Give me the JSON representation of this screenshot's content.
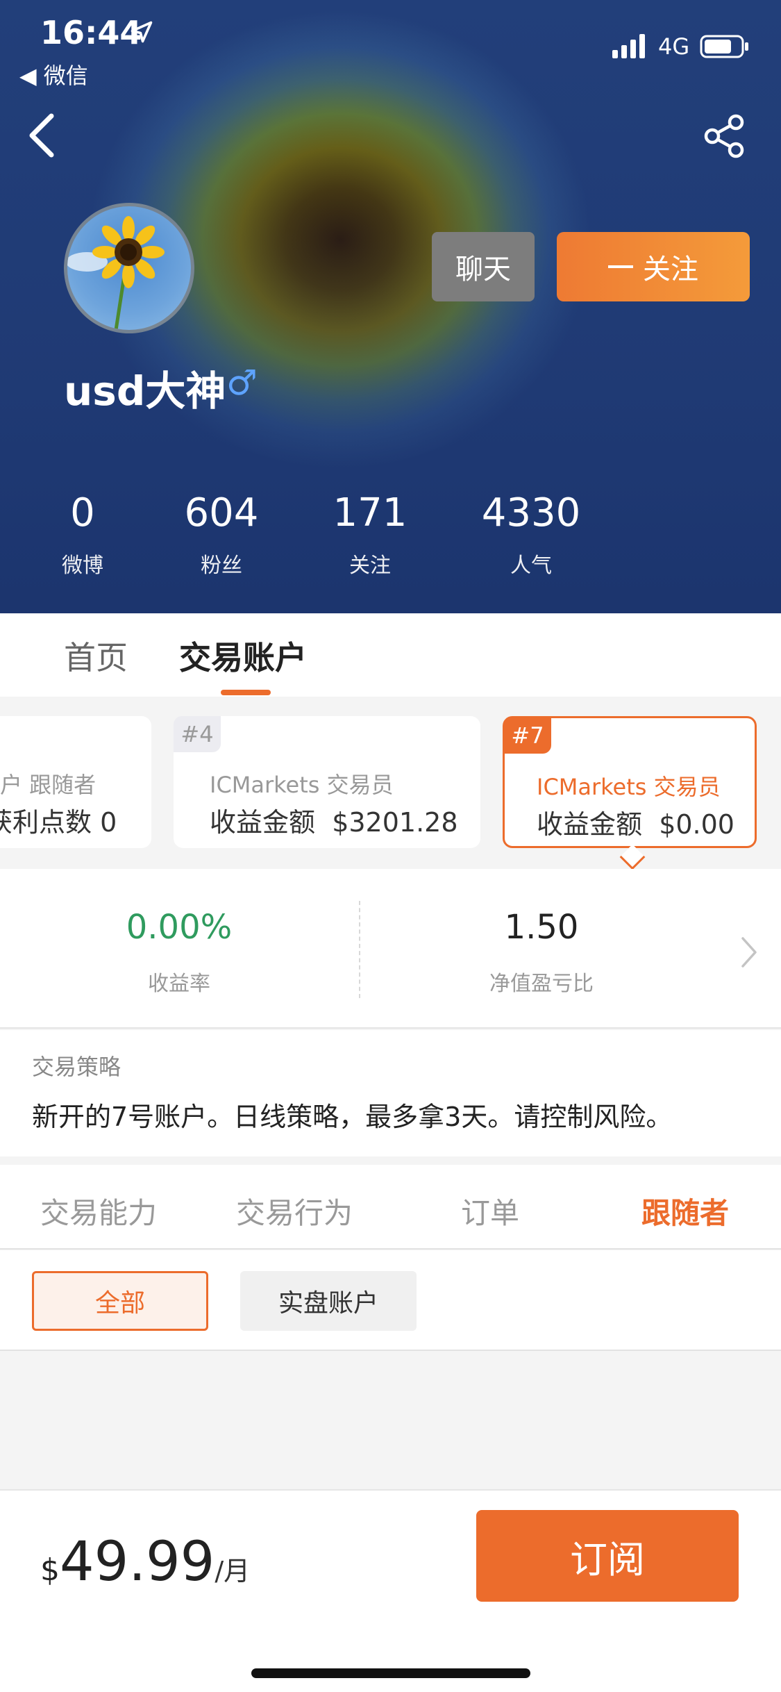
{
  "status_bar": {
    "time": "16:44",
    "back_app": "◀ 微信",
    "network": "4G"
  },
  "header": {
    "chat_label": "聊天",
    "follow_label": "关注",
    "follow_icon": "plus-line",
    "username": "usd大神",
    "gender_icon": "♂",
    "stats": [
      {
        "value": "0",
        "label": "微博"
      },
      {
        "value": "604",
        "label": "粉丝"
      },
      {
        "value": "171",
        "label": "关注"
      },
      {
        "value": "4330",
        "label": "人气"
      }
    ]
  },
  "profile_tabs": {
    "home": "首页",
    "accounts": "交易账户"
  },
  "account_cards": [
    {
      "line1": "户  跟随者",
      "line2": "获利点数   0"
    },
    {
      "rank": "#4",
      "line1": "ICMarkets   交易员",
      "line2_label": "收益金额",
      "line2_value": "$3201.28"
    },
    {
      "rank": "#7",
      "line1": "ICMarkets   交易员",
      "line2_label": "收益金额",
      "line2_value": "$0.00"
    }
  ],
  "metrics": {
    "yield_value": "0.00%",
    "yield_label": "收益率",
    "ratio_value": "1.50",
    "ratio_label": "净值盈亏比"
  },
  "strategy": {
    "title": "交易策略",
    "text": "新开的7号账户。日线策略，最多拿3天。请控制风险。"
  },
  "sub_tabs": [
    "交易能力",
    "交易行为",
    "订单",
    "跟随者"
  ],
  "sub_tabs_active": "跟随者",
  "filters": {
    "all": "全部",
    "real": "实盘账户"
  },
  "bottom_bar": {
    "currency": "$",
    "price": "49.99",
    "period": "/月",
    "subscribe_label": "订阅"
  },
  "colors": {
    "accent": "#ec6c2c",
    "positive": "#2f9b5e",
    "header_blue": "#223f7a"
  }
}
